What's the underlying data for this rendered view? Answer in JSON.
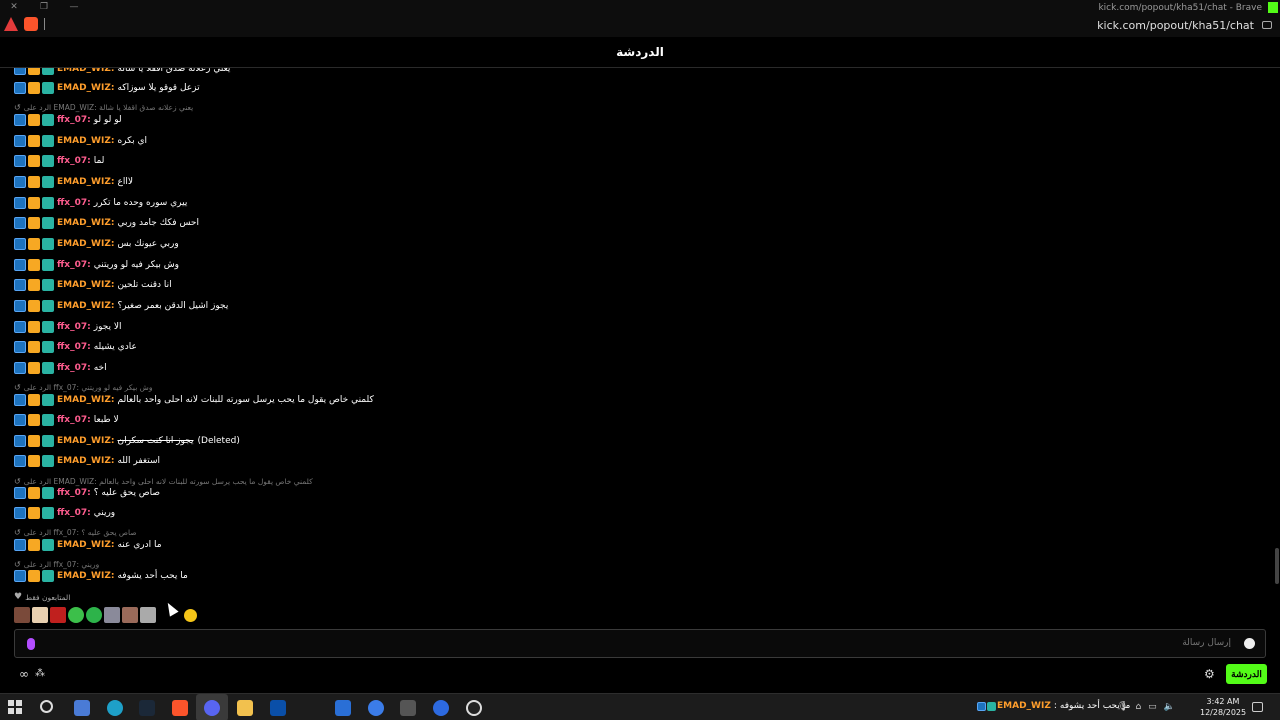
{
  "browser": {
    "window_title": "kick.com/popout/kha51/chat - Brave",
    "url": "kick.com/popout/kha51/chat",
    "brand_color": "#53fc18"
  },
  "chat": {
    "header_title": "الدردشة",
    "messages": [
      {
        "user": "EMAD_WIZ",
        "color": "orange",
        "text": "تزعل قوقو يلا سوزاكه"
      },
      {
        "reply_to": "الرد على EMAD_WIZ: يعني زعلانه صدق اقفلا يا شالة"
      },
      {
        "user": "ffx_07",
        "color": "pink",
        "text": "لو لو لو"
      },
      {
        "user": "EMAD_WIZ",
        "color": "orange",
        "text": "اي بكره"
      },
      {
        "user": "ffx_07",
        "color": "pink",
        "text": "لما"
      },
      {
        "user": "EMAD_WIZ",
        "color": "orange",
        "text": "لاااع"
      },
      {
        "user": "ffx_07",
        "color": "pink",
        "text": "ييري سوره وحده ما تكرر"
      },
      {
        "user": "EMAD_WIZ",
        "color": "orange",
        "text": "احس فكك جامد وربي"
      },
      {
        "user": "EMAD_WIZ",
        "color": "orange",
        "text": "وربي عيونك بس"
      },
      {
        "user": "ffx_07",
        "color": "pink",
        "text": "وش بيكر فيه لو وريتني"
      },
      {
        "user": "EMAD_WIZ",
        "color": "orange",
        "text": "انا دقنت تلحين"
      },
      {
        "user": "EMAD_WIZ",
        "color": "orange",
        "text": "يجوز اشيل الدقن بعمر صغير؟"
      },
      {
        "user": "ffx_07",
        "color": "pink",
        "text": "الا يجوز"
      },
      {
        "user": "ffx_07",
        "color": "pink",
        "text": "عادي يشيله"
      },
      {
        "user": "ffx_07",
        "color": "pink",
        "text": "اخه"
      },
      {
        "reply_to": "الرد على ffx_07: وش بيكر فيه لو وريتني"
      },
      {
        "user": "EMAD_WIZ",
        "color": "orange",
        "text": "كلمني خاص يقول ما يحب يرسل سورته للبنات لانه احلى واحد بالعالم"
      },
      {
        "user": "ffx_07",
        "color": "pink",
        "text": "لا طبعا"
      },
      {
        "user": "EMAD_WIZ",
        "color": "orange",
        "text": "يجوز انا كنت سكران",
        "deleted": "(Deleted)"
      },
      {
        "user": "EMAD_WIZ",
        "color": "orange",
        "text": "استغفر الله"
      },
      {
        "reply_to": "الرد على EMAD_WIZ: كلمني خاص يقول ما يحب يرسل سورته للبنات لانه احلى واحد بالعالم"
      },
      {
        "user": "ffx_07",
        "color": "pink",
        "text": "صاص يحق عليه ؟"
      },
      {
        "user": "ffx_07",
        "color": "pink",
        "text": "وريني"
      },
      {
        "reply_to": "الرد على ffx_07: صاص يحق عليه ؟"
      },
      {
        "user": "EMAD_WIZ",
        "color": "orange",
        "text": "ما ادري عنه"
      },
      {
        "reply_to": "الرد على ffx_07: وريني"
      },
      {
        "user": "EMAD_WIZ",
        "color": "orange",
        "text": "ما يحب أحد يشوفه"
      }
    ],
    "supporters_label": "المتابعون فقط",
    "input_placeholder": "إرسال رسالة",
    "chat_button_label": "الدردشة"
  },
  "taskbar": {
    "tray_message_user": "EMAD_WIZ",
    "tray_message_text": "ما يحب أحد يشوفه",
    "time": "3:42 AM",
    "date": "12/28/2025"
  }
}
